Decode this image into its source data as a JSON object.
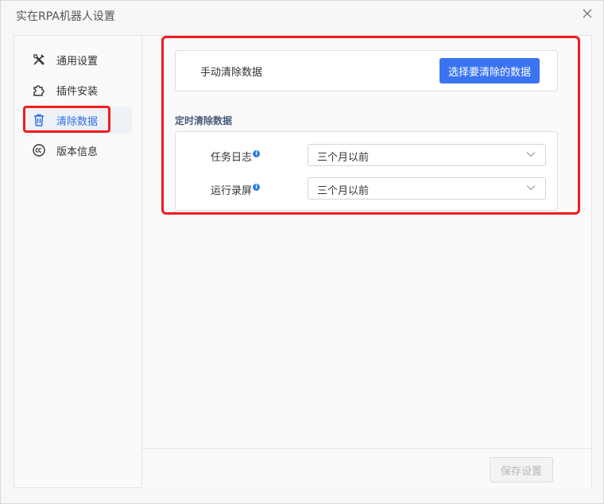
{
  "window": {
    "title": "实在RPA机器人设置"
  },
  "sidebar": {
    "items": [
      {
        "label": "通用设置",
        "icon": "tools-icon"
      },
      {
        "label": "插件安装",
        "icon": "puzzle-icon"
      },
      {
        "label": "清除数据",
        "icon": "trash-icon",
        "active": true
      },
      {
        "label": "版本信息",
        "icon": "copyright-icon"
      }
    ]
  },
  "manual_clear": {
    "label": "手动清除数据",
    "button_label": "选择要清除的数据"
  },
  "scheduled_clear": {
    "section_title": "定时清除数据",
    "rows": [
      {
        "label": "任务日志",
        "info": "i",
        "value": "三个月以前"
      },
      {
        "label": "运行录屏",
        "info": "i",
        "value": "三个月以前"
      }
    ]
  },
  "footer": {
    "save_label": "保存设置"
  },
  "colors": {
    "accent": "#3b74f1",
    "highlight": "#f21c1c",
    "active_text": "#2f6fe6"
  }
}
